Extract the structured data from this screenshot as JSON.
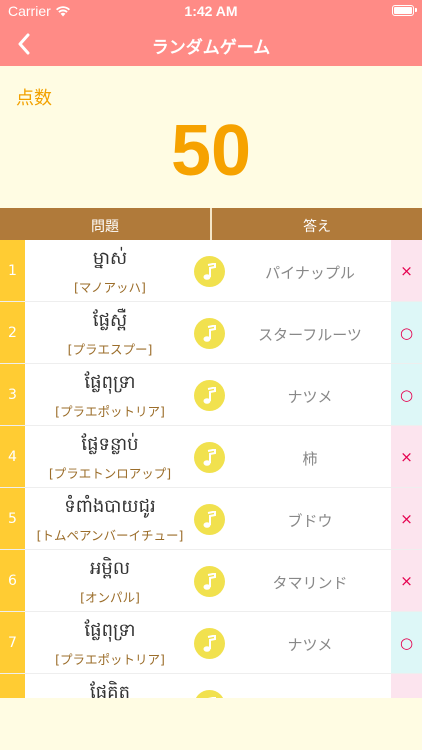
{
  "status": {
    "carrier": "Carrier",
    "time": "1:42 AM"
  },
  "nav": {
    "title": "ランダムゲーム"
  },
  "score": {
    "label": "点数",
    "value": "50"
  },
  "table": {
    "question_header": "問題",
    "answer_header": "答え"
  },
  "rows": [
    {
      "num": "1",
      "khmer": "ម្នាស់",
      "reading": "[マノアッハ]",
      "answer": "パイナップル",
      "result": "×",
      "result_type": "wrong"
    },
    {
      "num": "2",
      "khmer": "ផ្លែស្ពឺ",
      "reading": "[プラエスプー]",
      "answer": "スターフルーツ",
      "result": "○",
      "result_type": "correct"
    },
    {
      "num": "3",
      "khmer": "ផ្លែពុទ្រា",
      "reading": "[プラエポットリア]",
      "answer": "ナツメ",
      "result": "○",
      "result_type": "correct"
    },
    {
      "num": "4",
      "khmer": "ផ្លែទន្លាប់",
      "reading": "[プラエトンロアップ]",
      "answer": "柿",
      "result": "×",
      "result_type": "wrong"
    },
    {
      "num": "5",
      "khmer": "ទំពាំងបាយជូរ",
      "reading": "[トムペアンバーイチュー]",
      "answer": "ブドウ",
      "result": "×",
      "result_type": "wrong"
    },
    {
      "num": "6",
      "khmer": "អម្ពិល",
      "reading": "[オンパル]",
      "answer": "タマリンド",
      "result": "×",
      "result_type": "wrong"
    },
    {
      "num": "7",
      "khmer": "ផ្លែពុទ្រា",
      "reading": "[プラエポットリア]",
      "answer": "ナツメ",
      "result": "○",
      "result_type": "correct"
    },
    {
      "num": "",
      "khmer": "ផ្លែគិត",
      "reading": "",
      "answer": "",
      "result": "",
      "result_type": "pending"
    }
  ],
  "icons": {
    "back": "chevron-left-icon",
    "sound": "music-note-icon",
    "wifi": "wifi-icon",
    "battery": "battery-icon"
  },
  "colors": {
    "nav": "#FF8B86",
    "score": "#F6A200",
    "header": "#B07A3A",
    "number_bar": "#FFCC33",
    "sound": "#F1E14E",
    "wrong": "#E5004F"
  }
}
